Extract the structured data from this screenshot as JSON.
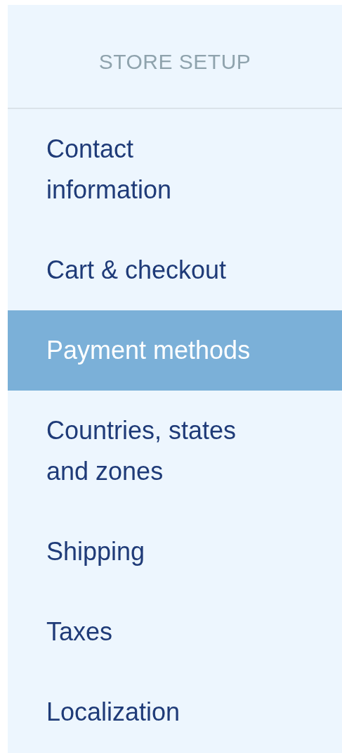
{
  "sidebar": {
    "heading": "STORE SETUP",
    "items": [
      {
        "label": "Contact information",
        "selected": false
      },
      {
        "label": "Cart & checkout",
        "selected": false
      },
      {
        "label": "Payment methods",
        "selected": true
      },
      {
        "label": "Countries, states and zones",
        "selected": false
      },
      {
        "label": "Shipping",
        "selected": false
      },
      {
        "label": "Taxes",
        "selected": false
      },
      {
        "label": "Localization",
        "selected": false
      }
    ]
  }
}
